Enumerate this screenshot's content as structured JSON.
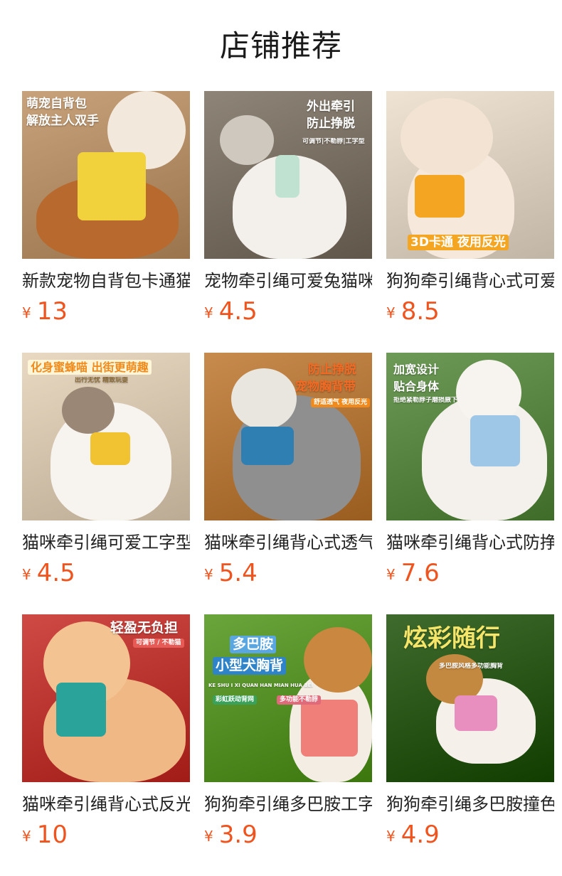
{
  "header": {
    "title": "店铺推荐"
  },
  "currency_symbol": "¥",
  "products": [
    {
      "name": "新款宠物自背包卡通猫咪牵引绳",
      "price": "13",
      "image_text": [
        "萌宠自背包",
        "解放主人双手"
      ],
      "colors": {
        "bg": "#c8a27a",
        "animal": "#b8692e",
        "head": "#f2e8dc",
        "gear": "#f1d23c"
      }
    },
    {
      "name": "宠物牵引绳可爱兔猫咪胸背带",
      "price": "4.5",
      "image_text": [
        "外出牵引",
        "防止挣脱",
        "可调节|不勒脖|工字型"
      ],
      "colors": {
        "bg": "#8e8578",
        "animal": "#f3f0ec",
        "head": "#cfc8bf",
        "gear": "#bfe3d0"
      }
    },
    {
      "name": "狗狗牵引绳背心式可爱卡通",
      "price": "8.5",
      "image_text": [
        "3D卡通 夜用反光"
      ],
      "colors": {
        "bg": "#efe3d3",
        "animal": "#f6e8db",
        "head": "#f3e3d2",
        "gear": "#f4a521"
      }
    },
    {
      "name": "猫咪牵引绳可爱工字型胸背带",
      "price": "4.5",
      "image_text": [
        "化身蜜蜂喵 出街更萌趣",
        "出行无忧 精致玩耍"
      ],
      "colors": {
        "bg": "#e9d9c2",
        "animal": "#f7f3ee",
        "head": "#9a8776",
        "gear": "#f1c232"
      }
    },
    {
      "name": "猫咪牵引绳背心式透气胸背带",
      "price": "5.4",
      "image_text": [
        "防止挣脱",
        "宠物胸背带",
        "舒适透气 夜用反光"
      ],
      "colors": {
        "bg": "#c88b4e",
        "animal": "#8f8f8f",
        "head": "#e9e6df",
        "gear": "#2f7fb3"
      }
    },
    {
      "name": "猫咪牵引绳背心式防挣脱",
      "price": "7.6",
      "image_text": [
        "加宽设计",
        "贴合身体",
        "拒绝紧勒脖子磨损腋下"
      ],
      "colors": {
        "bg": "#6d9a57",
        "animal": "#f4f1ec",
        "head": "#f7f4ef",
        "gear": "#9ec6e6"
      }
    },
    {
      "name": "猫咪牵引绳背心式反光胸背带",
      "price": "10",
      "image_text": [
        "轻盈无负担",
        "可调节 / 不勒猫"
      ],
      "colors": {
        "bg": "#d04a45",
        "animal": "#f0b885",
        "head": "#f3c492",
        "gear": "#2aa39a"
      }
    },
    {
      "name": "狗狗牵引绳多巴胺工字型",
      "price": "3.9",
      "image_text": [
        "多巴胺",
        "小型犬胸背",
        "KE SHU I XI QUAN HAN MIAN HUA BEI",
        "彩虹跃动背网",
        "多功能不勒脖"
      ],
      "colors": {
        "bg": "#6aa53c",
        "animal": "#f3ede4",
        "head": "#c9873f",
        "gear": "#f07f7a"
      }
    },
    {
      "name": "狗狗牵引绳多巴胺撞色胸背",
      "price": "4.9",
      "image_text": [
        "炫彩随行",
        "多巴胺风格多功能胸背"
      ],
      "colors": {
        "bg": "#3f6b2e",
        "animal": "#f5f1ea",
        "head": "#c48940",
        "gear": "#e88fc0"
      }
    }
  ]
}
